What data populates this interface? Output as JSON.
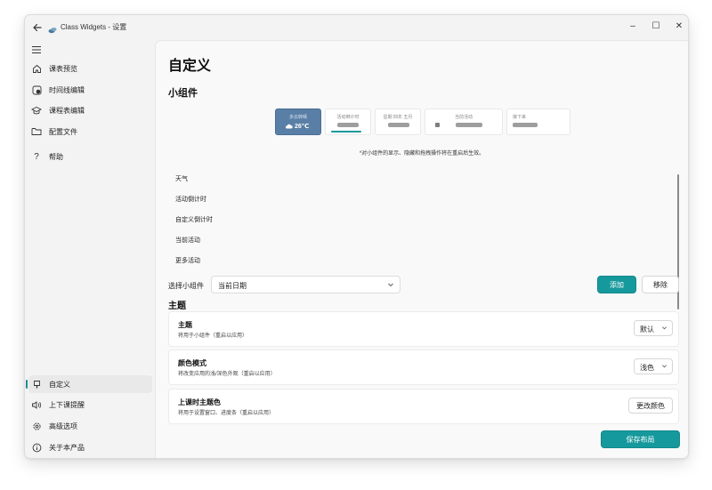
{
  "window": {
    "title": "Class Widgets - 设置",
    "controls": {
      "minimize": "–",
      "maximize": "☐",
      "close": "✕"
    }
  },
  "sidebar": {
    "top_items": [
      {
        "label": "课表预览",
        "icon": "home-icon"
      },
      {
        "label": "时间线编辑",
        "icon": "clock-edit-icon"
      },
      {
        "label": "课程表编辑",
        "icon": "education-icon"
      },
      {
        "label": "配置文件",
        "icon": "folder-icon"
      },
      {
        "label": "帮助",
        "icon": "help-icon"
      }
    ],
    "bottom_items": [
      {
        "label": "自定义",
        "icon": "brush-icon",
        "active": true
      },
      {
        "label": "上下课提醒",
        "icon": "speaker-icon"
      },
      {
        "label": "高级选项",
        "icon": "gear-icon"
      },
      {
        "label": "关于本产品",
        "icon": "info-icon"
      }
    ]
  },
  "main": {
    "title": "自定义",
    "widgets_section": {
      "title": "小组件",
      "preview": {
        "weather": {
          "label": "多云转晴",
          "temp": "26℃"
        },
        "countdown": {
          "label": "活动倒计时"
        },
        "date": {
          "label": "星期 四年 五月"
        },
        "current": {
          "label": "当前活动"
        },
        "next": {
          "label": "接下来"
        }
      },
      "note": "*对小组件的显示、隐藏和拖拽操作将在重启后生效。",
      "list_items": [
        "天气",
        "活动倒计时",
        "自定义倒计时",
        "当前活动",
        "更多活动"
      ],
      "select_label": "选择小组件",
      "select_value": "当前日期",
      "add_label": "添加",
      "remove_label": "移除"
    },
    "theme_section": {
      "title": "主题",
      "settings": [
        {
          "title": "主题",
          "desc": "将用于小组件（重启以应用）",
          "control": "默认"
        },
        {
          "title": "颜色模式",
          "desc": "将改变应用的浅/深色外观（重启以应用）",
          "control": "浅色"
        },
        {
          "title": "上课时主题色",
          "desc": "将用于设置窗口、进度条（重启以应用）",
          "control": "更改颜色"
        }
      ]
    },
    "save_label": "保存布局"
  },
  "colors": {
    "accent": "#16999c",
    "weather_card": "#5a7fa6"
  }
}
